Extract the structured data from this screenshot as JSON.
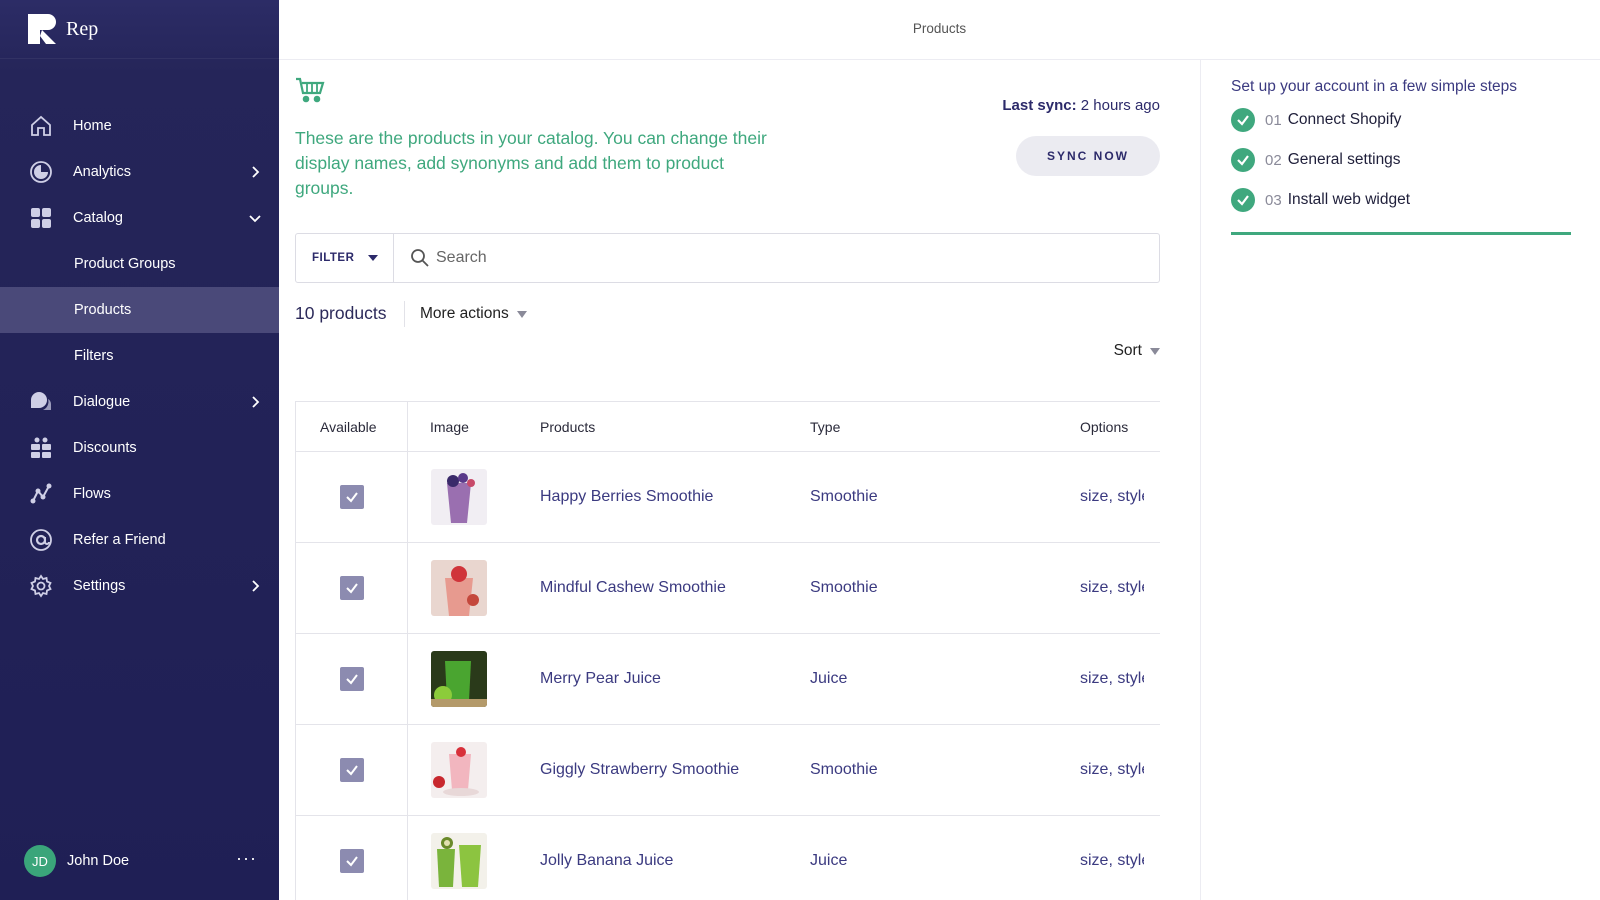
{
  "brand": {
    "name": "Rep"
  },
  "topbar": {
    "title": "Products"
  },
  "sidebar": {
    "items": [
      {
        "label": "Home",
        "icon": "home-icon"
      },
      {
        "label": "Analytics",
        "icon": "analytics-icon"
      },
      {
        "label": "Catalog",
        "icon": "catalog-icon"
      },
      {
        "label": "Product Groups"
      },
      {
        "label": "Products"
      },
      {
        "label": "Filters"
      },
      {
        "label": "Dialogue",
        "icon": "dialogue-icon"
      },
      {
        "label": "Discounts",
        "icon": "discounts-icon"
      },
      {
        "label": "Flows",
        "icon": "flows-icon"
      },
      {
        "label": "Refer a Friend",
        "icon": "refer-icon"
      },
      {
        "label": "Settings",
        "icon": "settings-icon"
      }
    ],
    "active": "Products",
    "user": {
      "initials": "JD",
      "name": "John Doe",
      "more": "···"
    }
  },
  "main": {
    "intro": "These are the products in your catalog. You can change their display names, add synonyms and add them to product groups.",
    "last_sync_label": "Last sync:",
    "last_sync_value": "2 hours ago",
    "sync_button": "SYNC NOW",
    "filter_label": "FILTER",
    "search_placeholder": "Search",
    "count": "10 products",
    "more_actions": "More actions",
    "sort": "Sort",
    "table": {
      "headers": [
        "Available",
        "Image",
        "Products",
        "Type",
        "Options"
      ],
      "rows": [
        {
          "available": true,
          "name": "Happy Berries Smoothie",
          "type": "Smoothie",
          "options": "size, style"
        },
        {
          "available": true,
          "name": "Mindful Cashew Smoothie",
          "type": "Smoothie",
          "options": "size, style"
        },
        {
          "available": true,
          "name": "Merry Pear Juice",
          "type": "Juice",
          "options": "size, style"
        },
        {
          "available": true,
          "name": "Giggly Strawberry Smoothie",
          "type": "Smoothie",
          "options": "size, style"
        },
        {
          "available": true,
          "name": "Jolly Banana Juice",
          "type": "Juice",
          "options": "size, style"
        }
      ]
    }
  },
  "setup": {
    "title": "Set up your account in a few simple steps",
    "steps": [
      {
        "num": "01",
        "label": "Connect Shopify",
        "done": true
      },
      {
        "num": "02",
        "label": "General settings",
        "done": true
      },
      {
        "num": "03",
        "label": "Install web widget",
        "done": true
      }
    ],
    "progress": 1.0
  },
  "colors": {
    "sidebar": "#1f1f55",
    "accent": "#3fa87e",
    "link": "#3b3a80",
    "checkbox": "#8c8bb0"
  }
}
